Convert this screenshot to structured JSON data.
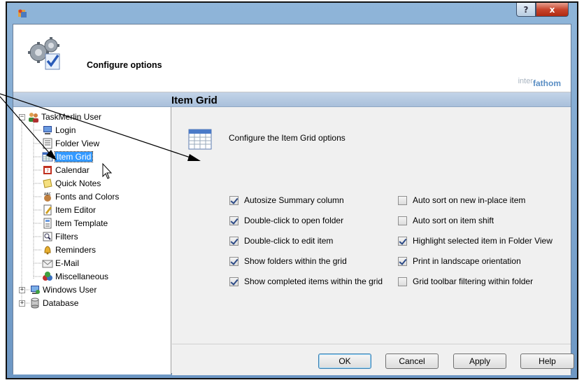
{
  "window": {
    "help_label": "?",
    "close_label": "x"
  },
  "header": {
    "title": "Configure options",
    "brand_prefix": "inter",
    "brand_suffix": "fathom"
  },
  "section": {
    "title": "Item Grid"
  },
  "tree": {
    "root1": "TaskMerlin User",
    "items": [
      {
        "label": "Login",
        "icon": "login-icon"
      },
      {
        "label": "Folder View",
        "icon": "folder-view-icon"
      },
      {
        "label": "Item Grid",
        "icon": "grid-icon",
        "selected": true
      },
      {
        "label": "Calendar",
        "icon": "calendar-icon"
      },
      {
        "label": "Quick Notes",
        "icon": "notes-icon"
      },
      {
        "label": "Fonts and Colors",
        "icon": "fonts-icon"
      },
      {
        "label": "Item Editor",
        "icon": "editor-icon"
      },
      {
        "label": "Item Template",
        "icon": "template-icon"
      },
      {
        "label": "Filters",
        "icon": "filter-icon"
      },
      {
        "label": "Reminders",
        "icon": "bell-icon"
      },
      {
        "label": "E-Mail",
        "icon": "email-icon"
      },
      {
        "label": "Miscellaneous",
        "icon": "misc-icon"
      }
    ],
    "root2": "Windows User",
    "root3": "Database",
    "expander_collapsed": "+",
    "expander_expanded": "−"
  },
  "panel": {
    "description": "Configure the Item Grid options",
    "left_options": [
      {
        "label": "Autosize Summary column",
        "checked": true
      },
      {
        "label": "Double-click to open folder",
        "checked": true
      },
      {
        "label": "Double-click to edit item",
        "checked": true
      },
      {
        "label": "Show folders within the grid",
        "checked": true
      },
      {
        "label": "Show completed items within the grid",
        "checked": true
      }
    ],
    "right_options": [
      {
        "label": "Auto sort on new in-place item",
        "checked": false
      },
      {
        "label": "Auto sort on item shift",
        "checked": false
      },
      {
        "label": "Highlight selected item in Folder View",
        "checked": true
      },
      {
        "label": "Print in landscape orientation",
        "checked": true
      },
      {
        "label": "Grid toolbar filtering within folder",
        "checked": false
      }
    ]
  },
  "footer": {
    "ok": "OK",
    "cancel": "Cancel",
    "apply": "Apply",
    "help": "Help"
  },
  "colors": {
    "selection": "#3399ff",
    "title_bar": "#8fb5d9",
    "close_button": "#c8452d",
    "brand": "#5a8ec4"
  }
}
